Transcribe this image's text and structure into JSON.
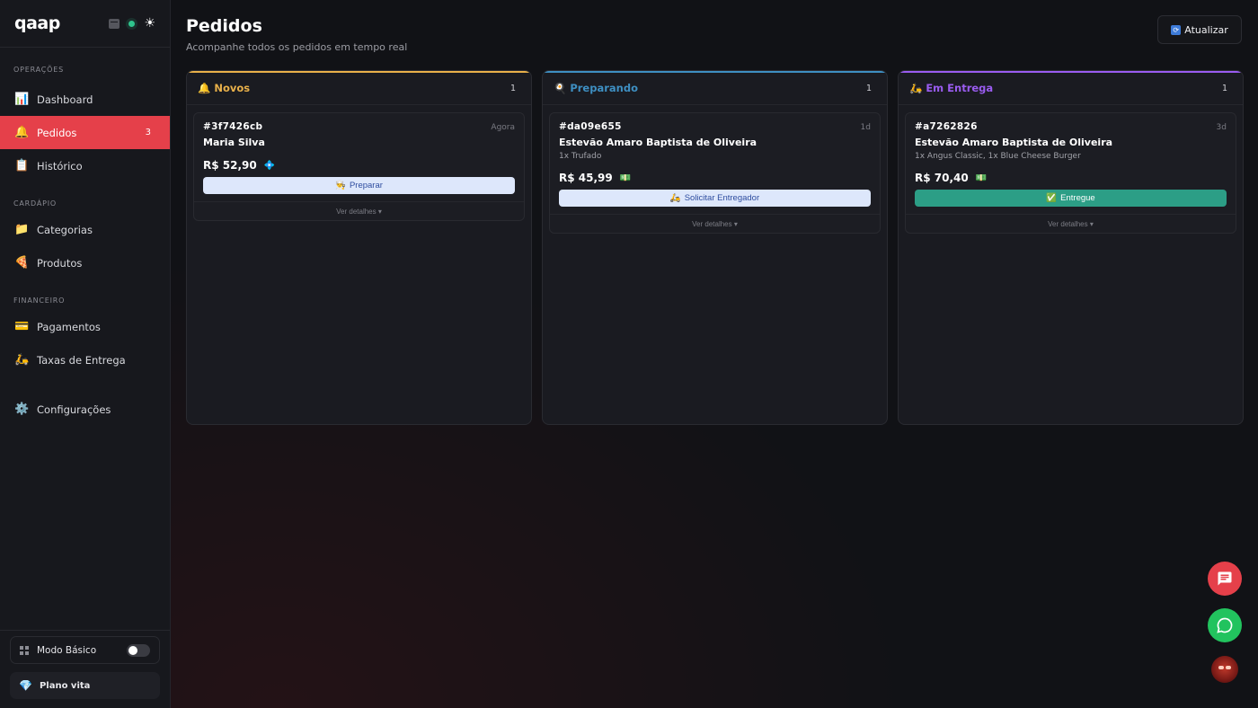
{
  "brand": {
    "logo_text": "qaap"
  },
  "sidebar": {
    "sections": [
      {
        "title": "OPERAÇÕES",
        "items": [
          {
            "label": "Dashboard",
            "icon": "chart-icon"
          },
          {
            "label": "Pedidos",
            "icon": "bell-icon",
            "badge": "3",
            "active": true
          },
          {
            "label": "Histórico",
            "icon": "clipboard-icon"
          }
        ]
      },
      {
        "title": "CARDÁPIO",
        "items": [
          {
            "label": "Categorias",
            "icon": "folder-icon"
          },
          {
            "label": "Produtos",
            "icon": "pizza-icon"
          }
        ]
      },
      {
        "title": "FINANCEIRO",
        "items": [
          {
            "label": "Pagamentos",
            "icon": "card-icon"
          },
          {
            "label": "Taxas de Entrega",
            "icon": "scooter-icon"
          }
        ]
      }
    ],
    "settings_label": "Configurações",
    "mode_label": "Modo Básico",
    "plan_label": "Plano vita"
  },
  "header": {
    "title": "Pedidos",
    "subtitle": "Acompanhe todos os pedidos em tempo real",
    "refresh_label": "Atualizar"
  },
  "columns": [
    {
      "title": "Novos",
      "count": "1",
      "emoji": "🔔",
      "accent": "#e8b04a",
      "cards": [
        {
          "id": "#3f7426cb",
          "time": "Agora",
          "name": "Maria Silva",
          "items": "",
          "price": "R$ 52,90",
          "payment_icon": "💠",
          "action": "Preparar",
          "action_emoji": "👨‍🍳",
          "action_style": "light",
          "details": "Ver detalhes ▾"
        }
      ]
    },
    {
      "title": "Preparando",
      "count": "1",
      "emoji": "🍳",
      "accent": "#3e8fc2",
      "cards": [
        {
          "id": "#da09e655",
          "time": "1d",
          "name": "Estevão Amaro Baptista de Oliveira",
          "items": "1x Trufado",
          "price": "R$ 45,99",
          "payment_icon": "💵",
          "action": "Solicitar Entregador",
          "action_emoji": "🛵",
          "action_style": "light",
          "details": "Ver detalhes ▾"
        }
      ]
    },
    {
      "title": "Em Entrega",
      "count": "1",
      "emoji": "🛵",
      "accent": "#9a5cf0",
      "cards": [
        {
          "id": "#a7262826",
          "time": "3d",
          "name": "Estevão Amaro Baptista de Oliveira",
          "items": "1x Angus Classic, 1x Blue Cheese Burger",
          "price": "R$ 70,40",
          "payment_icon": "💵",
          "action": "Entregue",
          "action_emoji": "✅",
          "action_style": "green",
          "details": "Ver detalhes ▾"
        }
      ]
    }
  ]
}
